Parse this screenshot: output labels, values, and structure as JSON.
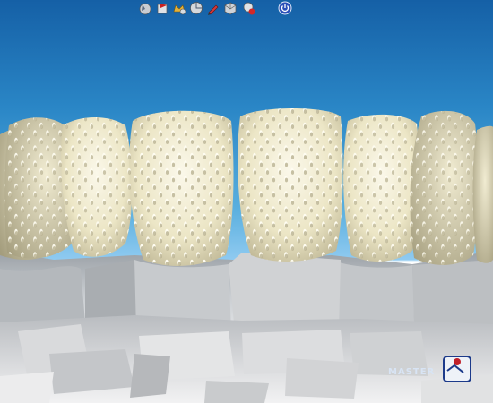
{
  "app": {
    "name": "dental-cad-3d-viewer"
  },
  "toolbar": {
    "tools": [
      {
        "name": "scan-tool-icon"
      },
      {
        "name": "flag-tool-icon"
      },
      {
        "name": "crown-tool-icon"
      },
      {
        "name": "segment-tool-icon"
      },
      {
        "name": "pencil-tool-icon"
      },
      {
        "name": "cube-tool-icon"
      },
      {
        "name": "delete-tool-icon"
      },
      {
        "name": "power-icon"
      }
    ]
  },
  "logo": {
    "text": "MASTER"
  }
}
